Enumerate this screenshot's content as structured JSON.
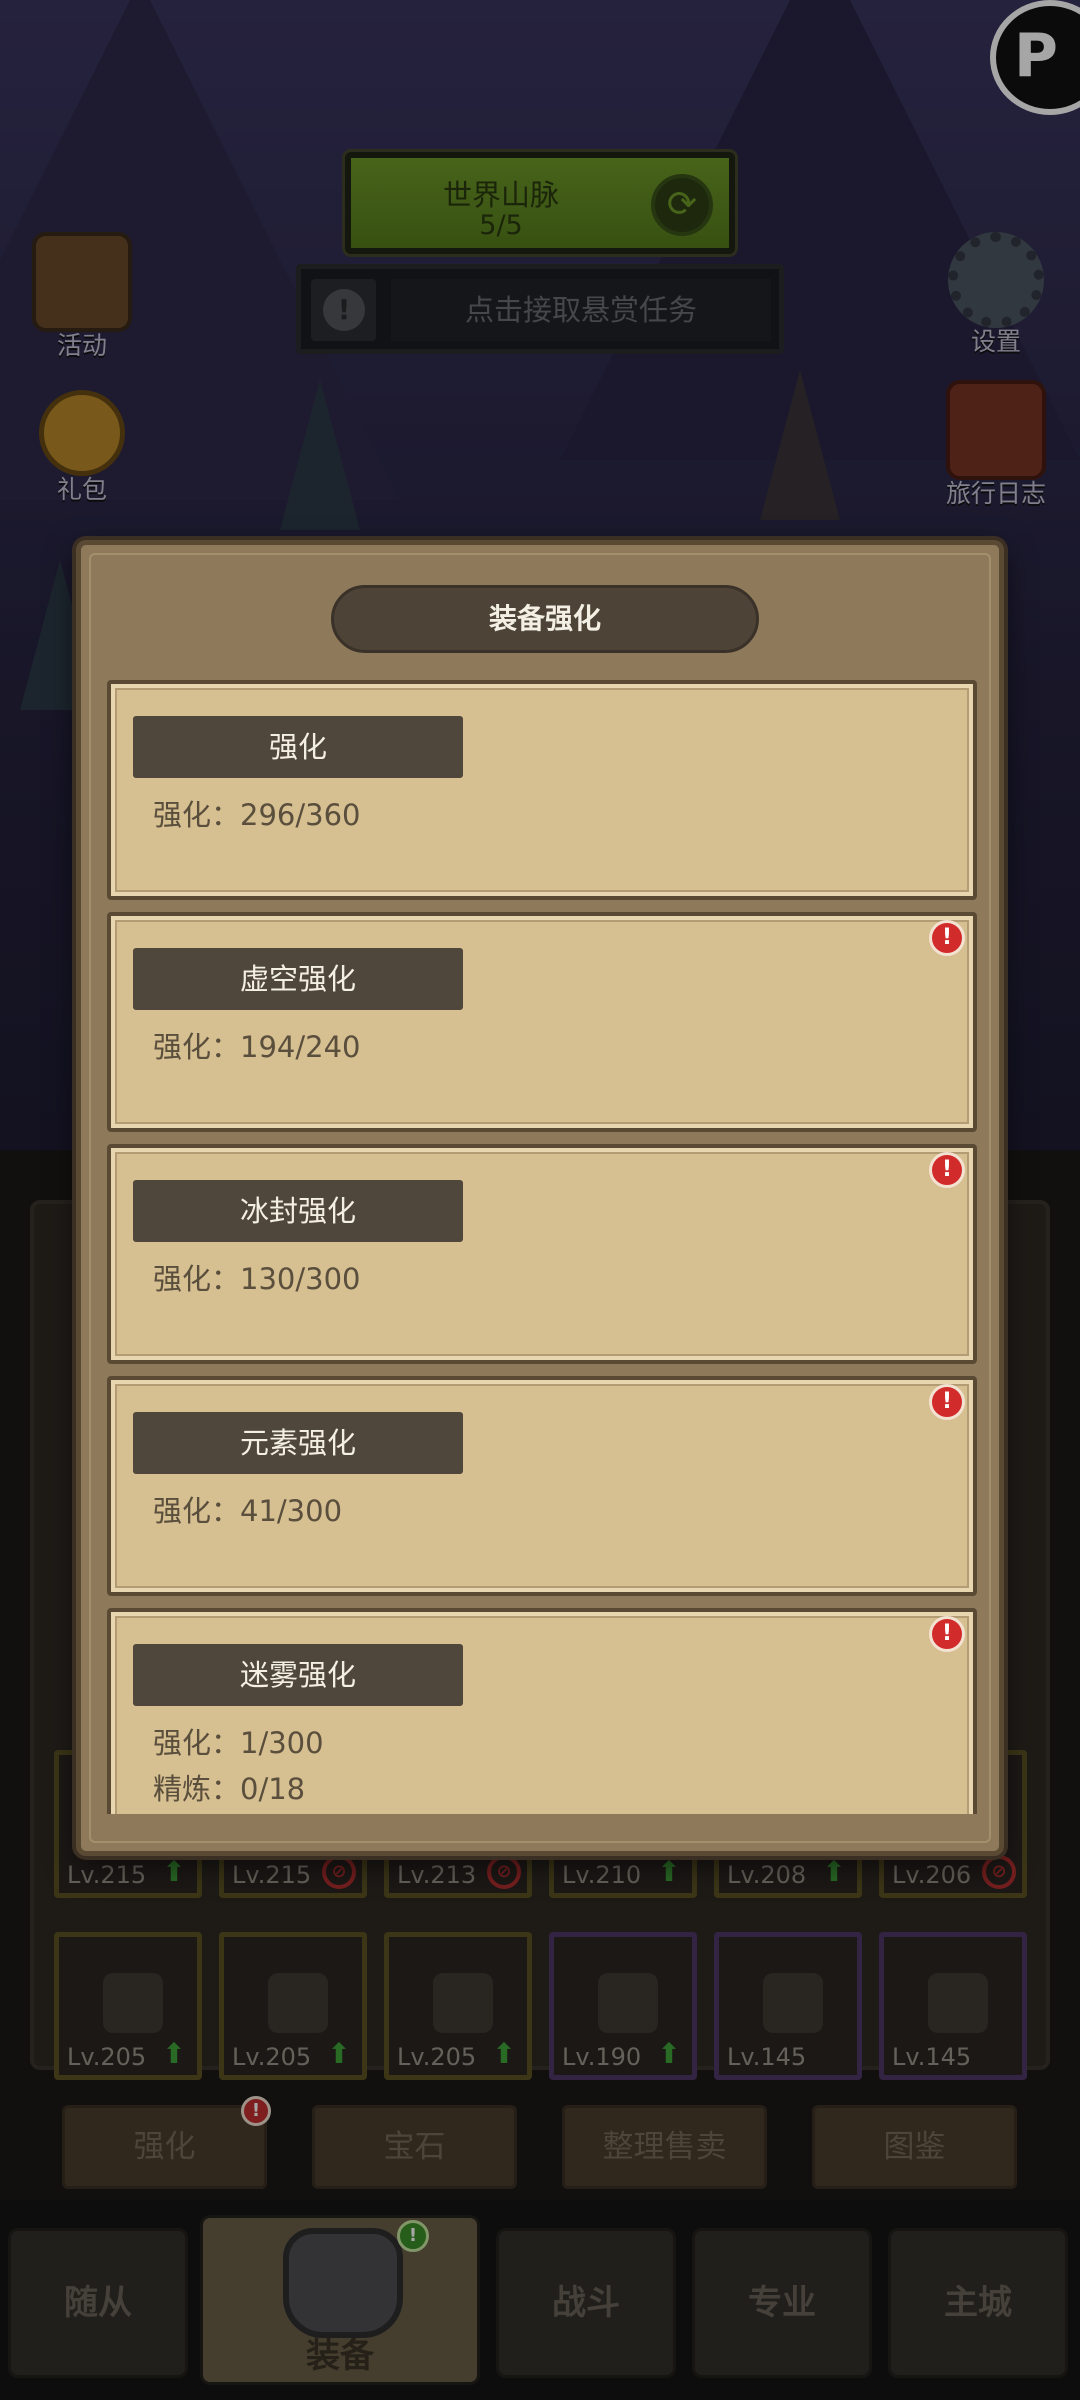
{
  "hud": {
    "world_title": "世界山脉",
    "world_progress": "5/5",
    "bounty_text": "点击接取悬赏任务",
    "left_icons": [
      "活动",
      "礼包"
    ],
    "right_icons": [
      "设置",
      "旅行日志"
    ]
  },
  "modal": {
    "title": "装备强化",
    "cards": [
      {
        "title": "强化",
        "lines": [
          "强化：296/360"
        ],
        "alert": false
      },
      {
        "title": "虚空强化",
        "lines": [
          "强化：194/240"
        ],
        "alert": true
      },
      {
        "title": "冰封强化",
        "lines": [
          "强化：130/300"
        ],
        "alert": true
      },
      {
        "title": "元素强化",
        "lines": [
          "强化：41/300"
        ],
        "alert": true
      },
      {
        "title": "迷雾强化",
        "lines": [
          "强化：1/300",
          "精炼：0/18"
        ],
        "alert": true
      }
    ]
  },
  "inventory": {
    "row1": [
      {
        "level": "Lv.215",
        "status": "up"
      },
      {
        "level": "Lv.215",
        "status": "no"
      },
      {
        "level": "Lv.213",
        "status": "no"
      },
      {
        "level": "Lv.210",
        "status": "up"
      },
      {
        "level": "Lv.208",
        "status": "up"
      },
      {
        "level": "Lv.206",
        "status": "no"
      }
    ],
    "row2": [
      {
        "level": "Lv.205",
        "status": "up"
      },
      {
        "level": "Lv.205",
        "status": "up"
      },
      {
        "level": "Lv.205",
        "status": "up"
      },
      {
        "level": "Lv.190",
        "status": "up"
      },
      {
        "level": "Lv.145",
        "status": ""
      },
      {
        "level": "Lv.145",
        "status": ""
      }
    ]
  },
  "actions": [
    "强化",
    "宝石",
    "整理售卖",
    "图鉴"
  ],
  "nav": {
    "items": [
      "随从",
      "装备",
      "战斗",
      "专业",
      "主城"
    ],
    "active": "装备"
  },
  "colors": {
    "panel": "#8e7a5a",
    "card": "#d6bf91",
    "title_bg": "#4f473b",
    "alert": "#d22b2b"
  }
}
